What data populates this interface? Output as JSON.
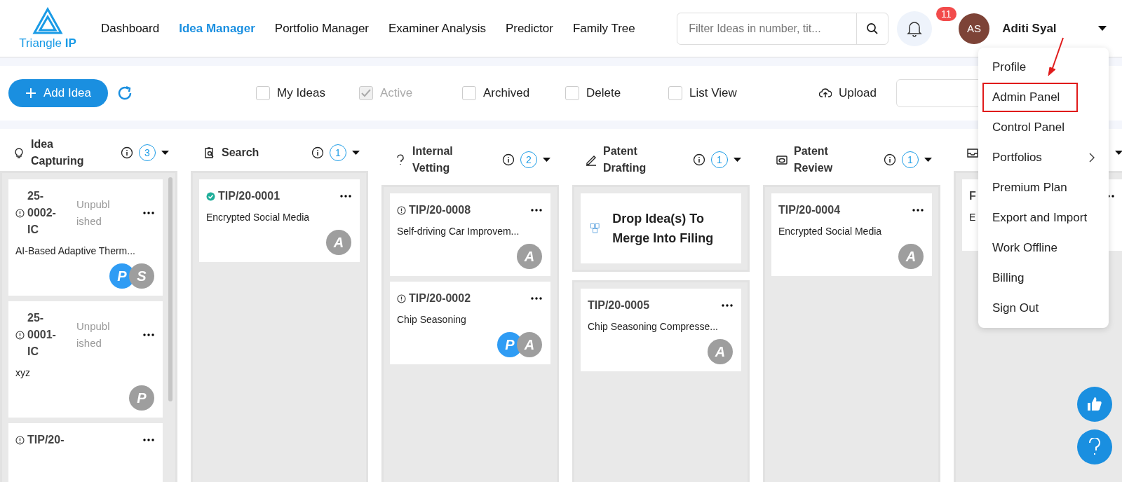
{
  "brand": {
    "name": "Triangle",
    "suffix": "IP"
  },
  "nav": [
    {
      "label": "Dashboard",
      "selected": false
    },
    {
      "label": "Idea Manager",
      "selected": true
    },
    {
      "label": "Portfolio Manager",
      "selected": false
    },
    {
      "label": "Examiner Analysis",
      "selected": false
    },
    {
      "label": "Predictor",
      "selected": false
    },
    {
      "label": "Family Tree",
      "selected": false
    }
  ],
  "search": {
    "placeholder": "Filter Ideas in number, tit..."
  },
  "notifications": {
    "count": "11"
  },
  "user": {
    "initials": "AS",
    "name": "Aditi Syal"
  },
  "toolbar": {
    "add_button": "Add Idea",
    "upload": "Upload",
    "filters": [
      {
        "label": "My Ideas",
        "checked": false,
        "disabled": false
      },
      {
        "label": "Active",
        "checked": true,
        "disabled": true
      },
      {
        "label": "Archived",
        "checked": false,
        "disabled": false
      },
      {
        "label": "Delete",
        "checked": false,
        "disabled": false
      },
      {
        "label": "List View",
        "checked": false,
        "disabled": false
      }
    ]
  },
  "columns": [
    {
      "title": "Idea Capturing",
      "count": "3",
      "cards": [
        {
          "id": "25-0002-IC",
          "kind": "info",
          "status": "Unpublished",
          "title": "AI-Based Adaptive Therm...",
          "avatars": [
            {
              "letter": "P",
              "color": "#2f9cf4"
            },
            {
              "letter": "S",
              "color": "#9e9e9e"
            }
          ]
        },
        {
          "id": "25-0001-IC",
          "kind": "info",
          "status": "Unpublished",
          "title": "xyz",
          "avatars": [
            {
              "letter": "P",
              "color": "#9e9e9e"
            }
          ]
        },
        {
          "id": "TIP/20-",
          "kind": "info"
        }
      ]
    },
    {
      "title": "Search",
      "count": "1",
      "cards": [
        {
          "id": "TIP/20-0001",
          "kind": "check",
          "title": "Encrypted Social Media",
          "avatars": [
            {
              "letter": "A",
              "color": "#9e9e9e"
            }
          ]
        }
      ]
    },
    {
      "title": "Internal Vetting",
      "count": "2",
      "cards": [
        {
          "id": "TIP/20-0008",
          "kind": "info",
          "title": "Self-driving Car Improvem...",
          "avatars": [
            {
              "letter": "A",
              "color": "#9e9e9e"
            }
          ]
        },
        {
          "id": "TIP/20-0002",
          "kind": "info",
          "title": "Chip Seasoning",
          "avatars": [
            {
              "letter": "P",
              "color": "#2f9cf4"
            },
            {
              "letter": "A",
              "color": "#9e9e9e"
            }
          ]
        }
      ]
    },
    {
      "title": "Patent Drafting",
      "count": "1",
      "drop_zone": "Drop Idea(s) To Merge Into Filing",
      "cards": [
        {
          "id": "TIP/20-0005",
          "title": "Chip Seasoning Compresse...",
          "avatars": [
            {
              "letter": "A",
              "color": "#9e9e9e"
            }
          ]
        }
      ]
    },
    {
      "title": "Patent Review",
      "count": "1",
      "cards": [
        {
          "id": "TIP/20-0004",
          "title": "Encrypted Social Media",
          "avatars": [
            {
              "letter": "A",
              "color": "#9e9e9e"
            }
          ]
        }
      ]
    },
    {
      "cards": [
        {
          "id": "F",
          "title": "E"
        }
      ]
    }
  ],
  "user_menu": [
    {
      "label": "Profile",
      "highlighted": false,
      "submenu": false
    },
    {
      "label": "Admin Panel",
      "highlighted": true,
      "submenu": false
    },
    {
      "label": "Control Panel",
      "highlighted": false,
      "submenu": false
    },
    {
      "label": "Portfolios",
      "highlighted": false,
      "submenu": true
    },
    {
      "label": "Premium Plan",
      "highlighted": false,
      "submenu": false
    },
    {
      "label": "Export and Import",
      "highlighted": false,
      "submenu": false
    },
    {
      "label": "Work Offline",
      "highlighted": false,
      "submenu": false
    },
    {
      "label": "Billing",
      "highlighted": false,
      "submenu": false
    },
    {
      "label": "Sign Out",
      "highlighted": false,
      "submenu": false
    }
  ]
}
